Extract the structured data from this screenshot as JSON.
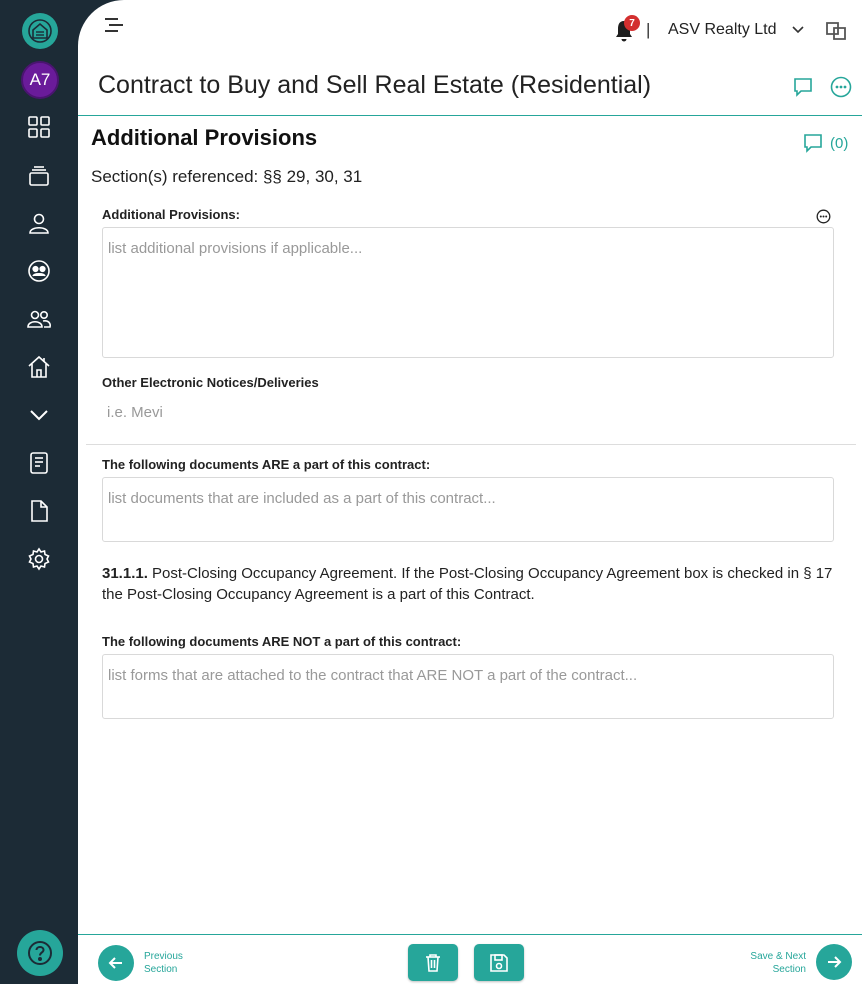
{
  "sidebar": {
    "avatar_initials": "A7",
    "items": [
      {
        "icon": "dashboard-grid-icon"
      },
      {
        "icon": "stack-icon"
      },
      {
        "icon": "user-icon"
      },
      {
        "icon": "group-circle-icon"
      },
      {
        "icon": "people-icon"
      },
      {
        "icon": "home-icon"
      },
      {
        "icon": "chevron-down-icon"
      },
      {
        "icon": "document-list-icon"
      },
      {
        "icon": "file-icon"
      },
      {
        "icon": "gear-icon"
      }
    ],
    "help_icon": "help-icon"
  },
  "header": {
    "notification_count": "7",
    "separator": "|",
    "company": "ASV Realty Ltd"
  },
  "page": {
    "title": "Contract to Buy and Sell Real Estate (Residential)"
  },
  "section": {
    "title": "Additional Provisions",
    "comment_count": "(0)",
    "referenced": "Section(s) referenced: §§ 29, 30, 31"
  },
  "fields": {
    "additional_provisions": {
      "label": "Additional Provisions:",
      "placeholder": "list additional provisions if applicable..."
    },
    "electronic_notices": {
      "label": "Other Electronic Notices/Deliveries",
      "placeholder": "i.e. Mevi"
    },
    "documents_included": {
      "label": "The following documents ARE a part of this contract:",
      "placeholder": "list documents that are included as a part of this contract..."
    },
    "clause": {
      "number": "31.1.1.",
      "text": " Post-Closing Occupancy Agreement. If the Post-Closing Occupancy Agreement box is checked in § 17 the Post-Closing Occupancy Agreement is a part of this Contract."
    },
    "documents_excluded": {
      "label": "The following documents ARE NOT a part of this contract:",
      "placeholder": "list forms that are attached to the contract that ARE NOT a part of the contract..."
    }
  },
  "footer": {
    "previous_line1": "Previous",
    "previous_line2": "Section",
    "next_line1": "Save & Next",
    "next_line2": "Section"
  },
  "colors": {
    "accent": "#26a69a",
    "sidebar": "#1c2b36",
    "badge": "#d32f2f",
    "avatar": "#6a1b9a"
  }
}
